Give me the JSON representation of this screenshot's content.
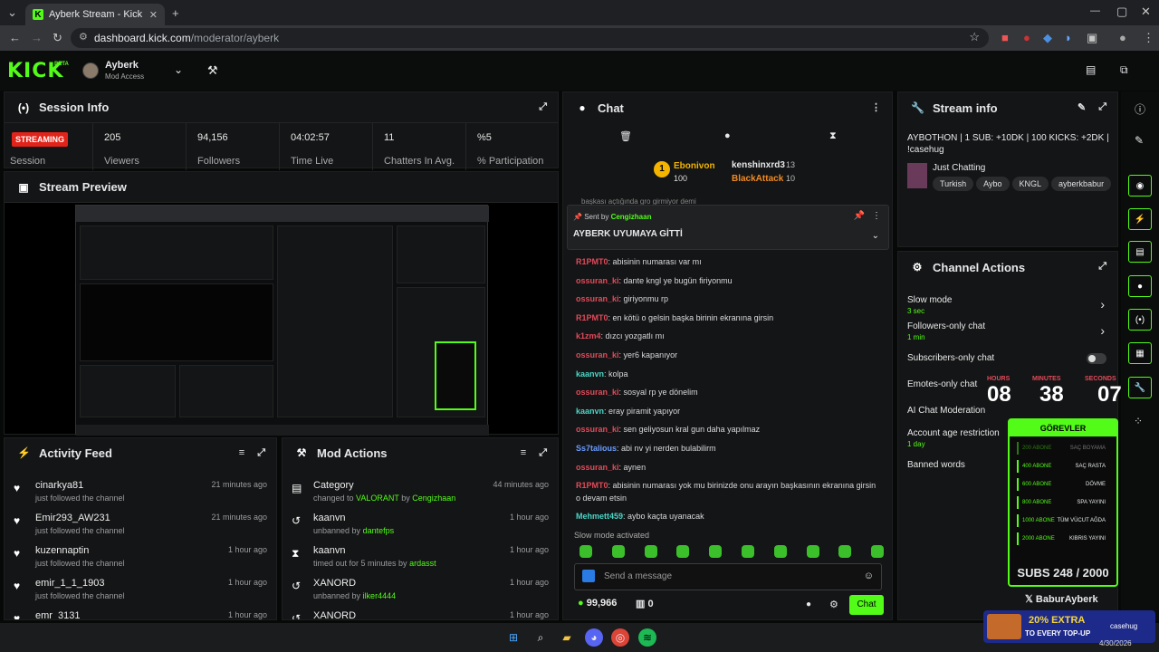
{
  "browser": {
    "tab_title": "Ayberk Stream - Kick Dashboard",
    "url_host": "dashboard.kick.com",
    "url_path": "/moderator/ayberk"
  },
  "nav": {
    "logo": "KICK",
    "beta": "BETA",
    "user_name": "Ayberk",
    "user_role": "Mod Access"
  },
  "session": {
    "title": "Session Info",
    "badge": "STREAMING",
    "badge_label": "Session",
    "stats": [
      {
        "value": "205",
        "label": "Viewers"
      },
      {
        "value": "94,156",
        "label": "Followers"
      },
      {
        "value": "04:02:57",
        "label": "Time Live"
      },
      {
        "value": "11",
        "label": "Chatters In Avg."
      },
      {
        "value": "%5",
        "label": "% Participation"
      }
    ]
  },
  "preview": {
    "title": "Stream Preview"
  },
  "activity": {
    "title": "Activity Feed",
    "items": [
      {
        "name": "cinarkya81",
        "sub": "just followed the channel",
        "time": "21 minutes ago"
      },
      {
        "name": "Emir293_AW231",
        "sub": "just followed the channel",
        "time": "21 minutes ago"
      },
      {
        "name": "kuzennaptin",
        "sub": "just followed the channel",
        "time": "1 hour ago"
      },
      {
        "name": "emir_1_1_1903",
        "sub": "just followed the channel",
        "time": "1 hour ago"
      },
      {
        "name": "emr_3131",
        "sub": "",
        "time": "1 hour ago"
      }
    ]
  },
  "mod": {
    "title": "Mod Actions",
    "items": [
      {
        "name": "Category",
        "pre": "changed to ",
        "hl": "VALORANT",
        "mid": " by ",
        "by": "Cengizhaan",
        "time": "44 minutes ago"
      },
      {
        "name": "kaanvn",
        "pre": "unbanned by ",
        "hl": "",
        "mid": "",
        "by": "dantefps",
        "time": "1 hour ago"
      },
      {
        "name": "kaanvn",
        "pre": "timed out for 5 minutes by ",
        "hl": "",
        "mid": "",
        "by": "ardasst",
        "time": "1 hour ago"
      },
      {
        "name": "XANORD",
        "pre": "unbanned by ",
        "hl": "",
        "mid": "",
        "by": "ilker4444",
        "time": "1 hour ago"
      },
      {
        "name": "XANORD",
        "pre": "",
        "hl": "",
        "mid": "",
        "by": "",
        "time": "1 hour ago"
      }
    ]
  },
  "chat": {
    "title": "Chat",
    "top_gifter": "Ebonivon",
    "top_gifter_amount": "100",
    "gifter2": "kenshinxrd3",
    "gifter2_amount": "13",
    "gifter3": "BlackAttack",
    "gifter3_amount": "10",
    "cut_line": "başkası açtığında gro girmiyor demi",
    "pinned_by_label": "Sent by",
    "pinned_by": "Cengizhaan",
    "pinned_msg": "AYBERK UYUMAYA GİTTİ",
    "messages": [
      {
        "user": "R1PMT0",
        "color": "#e24a5a",
        "text": "abisinin numarası var mı"
      },
      {
        "user": "ossuran_ki",
        "color": "#e24a5a",
        "text": "dante kngl ye bugün firiyonmu"
      },
      {
        "user": "ossuran_ki",
        "color": "#e24a5a",
        "text": "giriyonmu rp"
      },
      {
        "user": "R1PMT0",
        "color": "#e24a5a",
        "text": "en kötü o gelsin başka birinin ekranına girsin"
      },
      {
        "user": "k1zm4",
        "color": "#e24a5a",
        "text": "dızcı yozgatlı mı"
      },
      {
        "user": "ossuran_ki",
        "color": "#e24a5a",
        "text": "yer6 kapanıyor"
      },
      {
        "user": "kaanvn",
        "color": "#4ad6c8",
        "text": "kolpa"
      },
      {
        "user": "ossuran_ki",
        "color": "#e24a5a",
        "text": "sosyal rp ye dönelim"
      },
      {
        "user": "kaanvn",
        "color": "#4ad6c8",
        "text": "eray piramit yapıyor"
      },
      {
        "user": "ossuran_ki",
        "color": "#e24a5a",
        "text": "sen geliyosun kral gun daha yapılmaz"
      },
      {
        "user": "Ss7talious",
        "color": "#6a9cff",
        "text": "abi nv yi nerden bulabilirm"
      },
      {
        "user": "ossuran_ki",
        "color": "#e24a5a",
        "text": "aynen"
      },
      {
        "user": "R1PMT0",
        "color": "#e24a5a",
        "text": "abisinin numarası yok mu birinizde onu arayın başkasının ekranına girsin o devam etsin"
      },
      {
        "user": "Mehmett459",
        "color": "#4ad6c8",
        "text": "aybo kaçta uyanacak"
      }
    ],
    "slow_mode_note": "Slow mode activated",
    "input_placeholder": "Send a message",
    "points": "99,966",
    "gifts": "0",
    "send_label": "Chat"
  },
  "stream_info": {
    "title": "Stream info",
    "stream_title": "AYBOTHON | 1 SUB: +10DK | 100 KICKS: +2DK | !casehug",
    "category": "Just Chatting",
    "tags": [
      "Turkish",
      "Aybo",
      "KNGL",
      "ayberkbabur"
    ]
  },
  "channel_actions": {
    "title": "Channel Actions",
    "rows": [
      {
        "label": "Slow mode",
        "sub": "3 sec"
      },
      {
        "label": "Followers-only chat",
        "sub": "1 min"
      },
      {
        "label": "Subscribers-only chat",
        "sub": ""
      },
      {
        "label": "Emotes-only chat",
        "sub": ""
      },
      {
        "label": "AI Chat Moderation",
        "sub": ""
      },
      {
        "label": "Account age restriction",
        "sub": "1 day"
      },
      {
        "label": "Banned words",
        "sub": ""
      }
    ]
  },
  "overlay": {
    "hours_label": "HOURS",
    "minutes_label": "MINUTES",
    "seconds_label": "SECONDS",
    "hours": "08",
    "minutes": "38",
    "seconds": "07",
    "gorevler": "GÖREVLER",
    "subs": "SUBS 248 / 2000",
    "handle": "BaburAyberk",
    "tasks": [
      {
        "n": "200 ABONE",
        "t": "SAÇ BOYAMA"
      },
      {
        "n": "400 ABONE",
        "t": "SAÇ RASTA"
      },
      {
        "n": "600 ABONE",
        "t": "DÖVME"
      },
      {
        "n": "800 ABONE",
        "t": "SPA YAYINI"
      },
      {
        "n": "1000 ABONE",
        "t": "TÜM VÜCUT AĞDA"
      },
      {
        "n": "2000 ABONE",
        "t": "KIBRIS YAYINI"
      }
    ],
    "promo": "20% EXTRA",
    "promo2": "TO EVERY TOP-UP",
    "brand": "casehug"
  },
  "taskbar": {
    "date": "4/30/2026"
  }
}
